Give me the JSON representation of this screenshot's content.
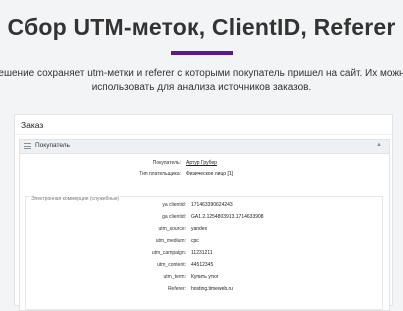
{
  "hero": {
    "title": "Сбор UTM-меток, ClientID, Referer",
    "description_line1": "ешение сохраняет utm-метки и referer с которыми покупатель пришел на сайт. Их можн",
    "description_line2": "использовать для анализа источников заказов."
  },
  "colors": {
    "accent": "#5b1a8c",
    "link": "#3b78c2"
  },
  "order_card": {
    "title": "Заказ",
    "section": {
      "label": "Покупатель",
      "menu_icon": "menu-icon",
      "collapse_icon": "chevron-up-icon",
      "buyer_label": "Покупатель:",
      "buyer_value": "Артур Грубер",
      "payer_type_label": "Тип плательщика:",
      "payer_type_value": "Физическое лицо [1]",
      "ecommerce_label": "Электронная коммерция (служебные)",
      "fields": [
        {
          "key": "ya clientid:",
          "value": "171463390624243"
        },
        {
          "key": "ga clientid:",
          "value": "GA1.2.1254803913.1714633908"
        },
        {
          "key": "utm_source:",
          "value": "yandex"
        },
        {
          "key": "utm_medium:",
          "value": "cpc"
        },
        {
          "key": "utm_campaign:",
          "value": "11231211"
        },
        {
          "key": "utm_content:",
          "value": "44512345"
        },
        {
          "key": "utm_term:",
          "value": "Купить утюг"
        },
        {
          "key": "Referer:",
          "value": "hosting.timeweb.ru"
        }
      ]
    }
  }
}
